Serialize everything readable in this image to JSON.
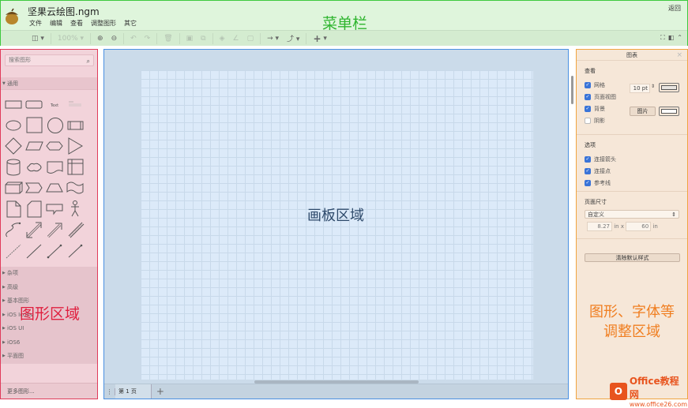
{
  "app": {
    "title": "坚果云绘图.ngm",
    "back": "返回",
    "menus": [
      "文件",
      "编辑",
      "查看",
      "调整图形",
      "其它"
    ],
    "annotation": "菜单栏"
  },
  "toolbar": {
    "zoom": "100%"
  },
  "left": {
    "search_placeholder": "搜索图形",
    "section": "通用",
    "text_shape": "Text",
    "shapes": [
      "rectangle",
      "rounded-rectangle",
      "text",
      "textbox",
      "ellipse",
      "square",
      "circle",
      "process",
      "diamond",
      "parallelogram",
      "hexagon",
      "triangle",
      "cylinder",
      "cloud",
      "document",
      "internal-storage",
      "cube",
      "step",
      "trapezoid",
      "tape",
      "note",
      "card",
      "callout",
      "actor",
      "curve",
      "bidirectional-arrow",
      "arrow",
      "link",
      "dashed-line",
      "line",
      "bidirectional-connector",
      "directional-connector"
    ],
    "categories": [
      "杂项",
      "高级",
      "基本图形",
      "iOS Icons",
      "iOS UI",
      "iOS6",
      "平面图"
    ],
    "more": "更多图形...",
    "annotation": "图形区域"
  },
  "canvas": {
    "annotation": "画板区域",
    "page_tab": "第 1 页"
  },
  "right": {
    "title": "图表",
    "view_heading": "查看",
    "view_options": [
      {
        "label": "网格",
        "checked": true
      },
      {
        "label": "页面视图",
        "checked": true
      },
      {
        "label": "背景",
        "checked": true
      },
      {
        "label": "阴影",
        "checked": false
      }
    ],
    "grid_size": "10 pt",
    "image_button": "图片",
    "options_heading": "选项",
    "options": [
      {
        "label": "连接箭头",
        "checked": true
      },
      {
        "label": "连接点",
        "checked": true
      },
      {
        "label": "参考线",
        "checked": true
      }
    ],
    "page_size_heading": "页面尺寸",
    "page_size": "自定义",
    "width": "8.27",
    "height": "60",
    "unit_x": "in x",
    "unit": "in",
    "clear_button": "清除默认样式",
    "annotation_line1": "图形、字体等",
    "annotation_line2": "调整区域"
  },
  "watermark": {
    "brand": "Office教程网",
    "url": "www.office26.com"
  }
}
